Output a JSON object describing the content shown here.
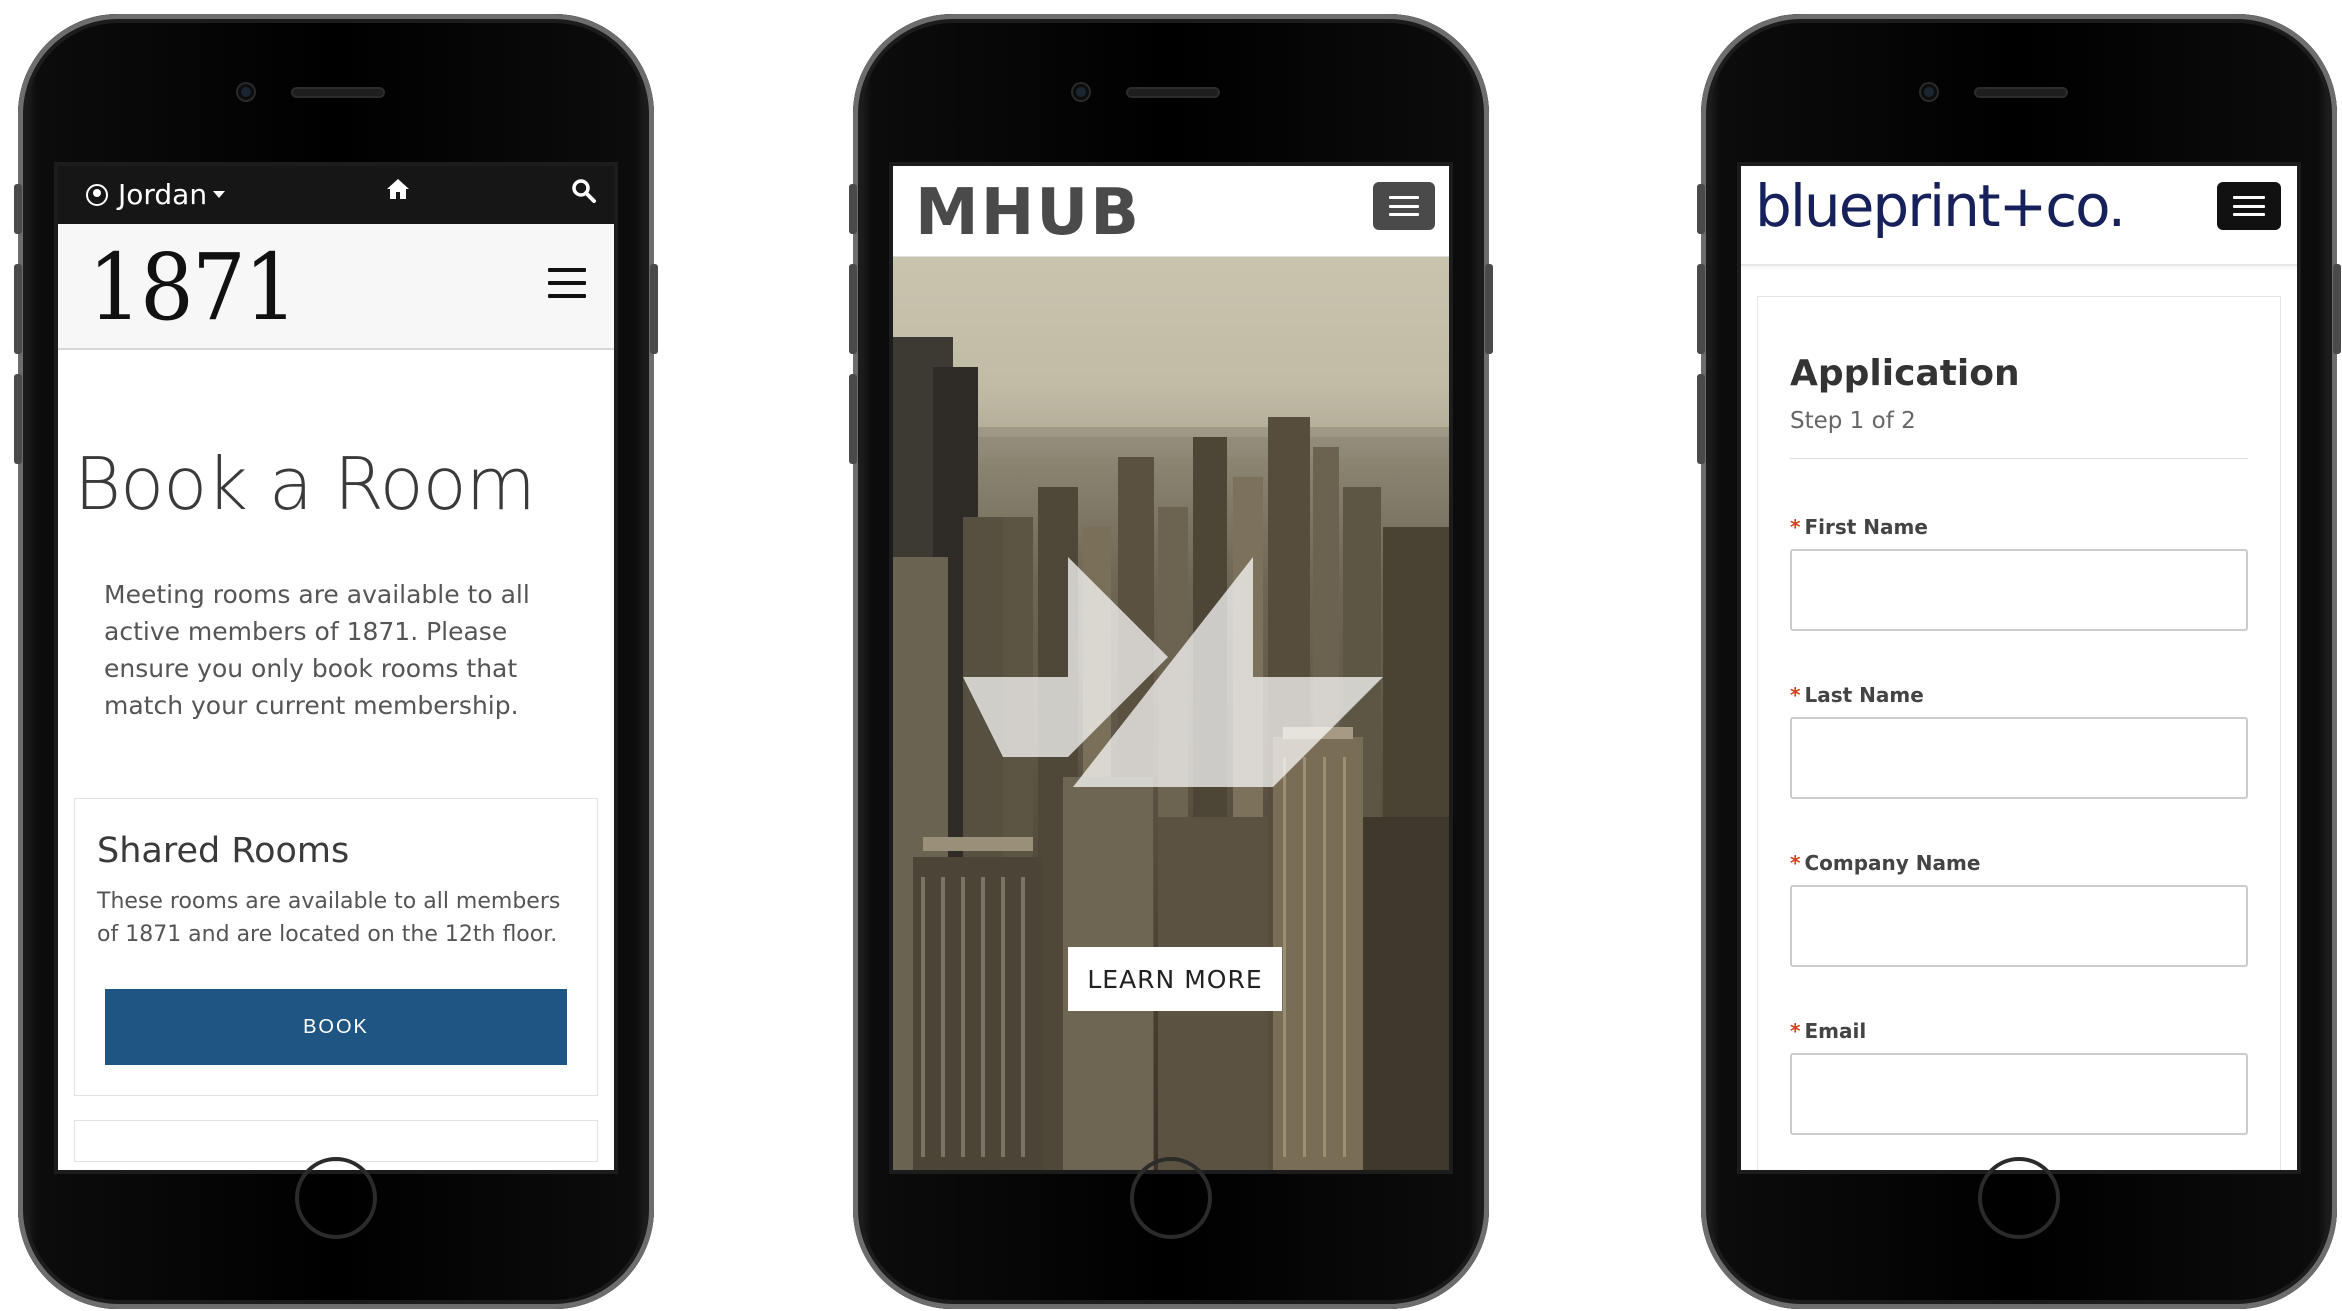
{
  "phone_1871": {
    "user_name": "Jordan",
    "logo_text": "1871",
    "page_title": "Book a Room",
    "description": "Meeting rooms are available to all active members of 1871. Please ensure you only book rooms that match your current membership.",
    "card_title": "Shared Rooms",
    "card_text": "These rooms are available to all members of 1871 and are located on the 12th floor.",
    "book_label": "BOOK",
    "accent": "#1f5582"
  },
  "phone_mhub": {
    "logo_text": "MHUB",
    "cta_label": "LEARN MORE"
  },
  "phone_blueprint": {
    "logo_text": "blueprint+co.",
    "form_title": "Application",
    "form_step": "Step 1 of 2",
    "required_marker": "*",
    "fields": [
      {
        "label": "First Name"
      },
      {
        "label": "Last Name"
      },
      {
        "label": "Company Name"
      },
      {
        "label": "Email"
      }
    ],
    "brand_color": "#16205a",
    "required_color": "#d93b1f"
  }
}
